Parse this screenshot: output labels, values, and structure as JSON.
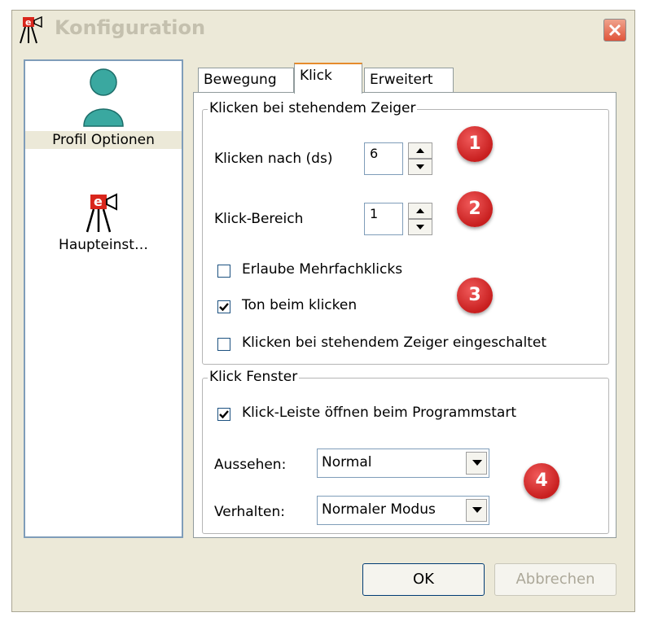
{
  "window": {
    "title": "Konfiguration"
  },
  "nav": {
    "items": [
      {
        "label": "Profil Optionen",
        "icon": "user-icon"
      },
      {
        "label": "Haupteinst…",
        "icon": "app-logo-icon"
      }
    ]
  },
  "tabs": {
    "items": [
      "Bewegung",
      "Klick",
      "Erweitert"
    ],
    "active": "Klick"
  },
  "group1": {
    "title": "Klicken bei stehendem Zeiger",
    "klicken_nach": {
      "label": "Klicken nach (ds)",
      "value": "6"
    },
    "klick_bereich": {
      "label": "Klick-Bereich",
      "value": "1"
    },
    "mehrfachklicks": {
      "label": "Erlaube Mehrfachklicks",
      "checked": false
    },
    "ton": {
      "label": "Ton beim klicken",
      "checked": true
    },
    "eingeschaltet": {
      "label": "Klicken bei stehendem Zeiger eingeschaltet",
      "checked": false
    }
  },
  "group2": {
    "title": "Klick Fenster",
    "klickleiste": {
      "label": "Klick-Leiste öffnen beim Programmstart",
      "checked": true
    },
    "aussehen": {
      "label": "Aussehen:",
      "value": "Normal"
    },
    "verhalten": {
      "label": "Verhalten:",
      "value": "Normaler Modus"
    }
  },
  "badges": [
    "1",
    "2",
    "3",
    "4"
  ],
  "buttons": {
    "ok": "OK",
    "cancel": "Abbrechen"
  },
  "colors": {
    "badge": "#d42a2a",
    "title_disabled": "#c4c0ae",
    "tab_active_accent": "#e68b2c"
  }
}
